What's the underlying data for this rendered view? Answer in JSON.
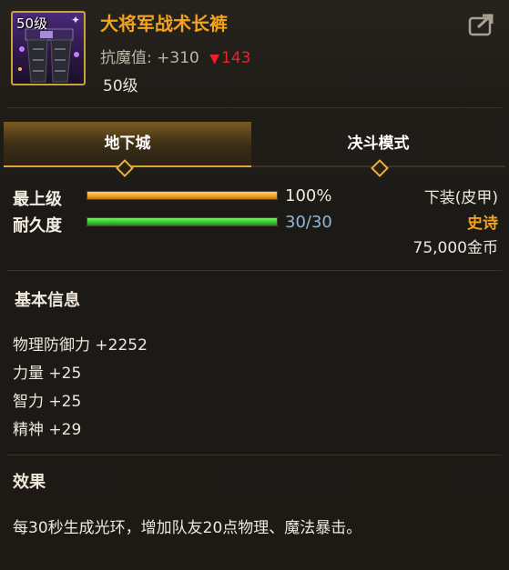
{
  "header": {
    "item_level_badge": "50级",
    "item_name": "大将军战术长裤",
    "resist_label": "抗魔值:",
    "resist_value": "+310",
    "resist_diff": "143",
    "required_level": "50级"
  },
  "tabs": [
    {
      "label": "地下城",
      "active": true
    },
    {
      "label": "决斗模式",
      "active": false
    }
  ],
  "stats": {
    "max_level_label": "最上级",
    "max_level_value": "100%",
    "max_level_fraction": 1.0,
    "durability_label": "耐久度",
    "durability_value": "30/30",
    "durability_fraction": 1.0
  },
  "item_info": {
    "slot_type": "下装(皮甲)",
    "rarity": "史诗",
    "price": "75,000金币"
  },
  "basic_info": {
    "title": "基本信息",
    "attributes": [
      "物理防御力 +2252",
      "力量 +25",
      "智力 +25",
      "精神 +29"
    ]
  },
  "effect": {
    "title": "效果",
    "text": "每30秒生成光环，增加队友20点物理、魔法暴击。"
  },
  "colors": {
    "item_name": "#f2a21c",
    "rarity": "#f2a21c",
    "diff_down": "#e8232a",
    "durability_value": "#8fb6d8",
    "frame_gold": "#c9a23a"
  },
  "icons": {
    "share": "share-export-icon",
    "tab_marker": "diamond-icon",
    "down_arrow": "down-triangle-icon"
  }
}
